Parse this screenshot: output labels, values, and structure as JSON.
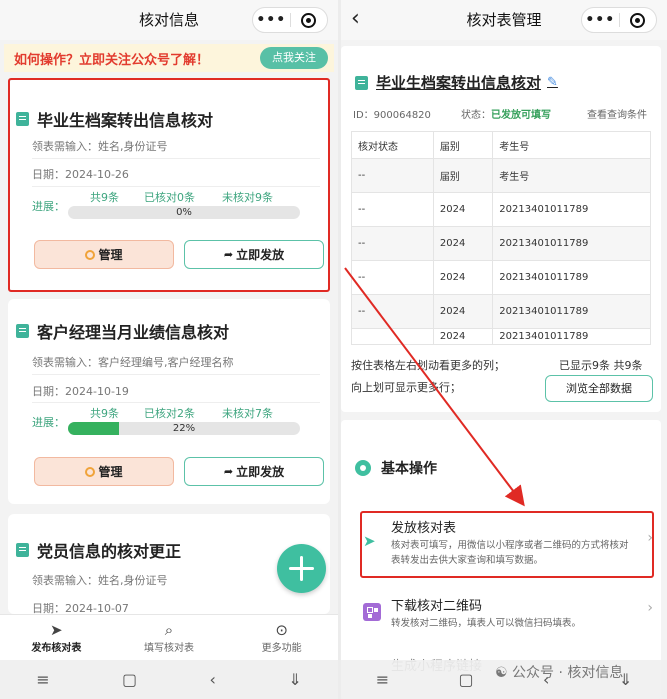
{
  "left": {
    "title": "核对信息",
    "banner": {
      "text": "如何操作？立即关注公众号了解！",
      "follow_label": "点我关注"
    },
    "cards": [
      {
        "title": "毕业生档案转出信息核对",
        "fields_label": "领表需输入：姓名,身份证号",
        "date_label": "日期：2024-10-26",
        "progress_label": "进展：",
        "total": "共9条",
        "checked": "已核对0条",
        "unchecked": "未核对9条",
        "progress_text": "0%",
        "progress_value": 0,
        "manage_label": "管理",
        "send_label": "立即发放"
      },
      {
        "title": "客户经理当月业绩信息核对",
        "fields_label": "领表需输入：客户经理编号,客户经理名称",
        "date_label": "日期：2024-10-19",
        "progress_label": "进展：",
        "total": "共9条",
        "checked": "已核对2条",
        "unchecked": "未核对7条",
        "progress_text": "22%",
        "progress_value": 22,
        "manage_label": "管理",
        "send_label": "立即发放"
      },
      {
        "title": "党员信息的核对更正",
        "fields_label": "领表需输入：姓名,身份证号",
        "date_label": "日期：2024-10-07"
      }
    ],
    "tabs": [
      {
        "label": "发布核对表",
        "icon": "send-icon"
      },
      {
        "label": "填写核对表",
        "icon": "search-icon"
      },
      {
        "label": "更多功能",
        "icon": "more-icon"
      }
    ]
  },
  "right": {
    "title": "核对表管理",
    "sheet_title": "毕业生档案转出信息核对",
    "id_label": "ID：900064820",
    "status_label": "状态：",
    "status_value": "已发放可填写",
    "view_conditions": "查看查询条件",
    "table": {
      "headers": [
        "核对状态",
        "届别",
        "考生号"
      ],
      "rows": [
        [
          "--",
          "届别",
          "考生号"
        ],
        [
          "--",
          "2024",
          "20213401011789"
        ],
        [
          "--",
          "2024",
          "20213401011789"
        ],
        [
          "--",
          "2024",
          "20213401011789"
        ],
        [
          "--",
          "2024",
          "20213401011789"
        ],
        [
          "",
          "2024",
          "20213401011789"
        ]
      ]
    },
    "hint1": "按住表格左右划动看更多的列；",
    "hint2": "向上划可显示更多行；",
    "shown_count": "已显示9条 共9条",
    "browse_label": "浏览全部数据",
    "section_title": "基本操作",
    "ops": [
      {
        "title": "发放核对表",
        "desc": "核对表可填写，用微信以小程序或者二维码的方式将核对表转发出去供大家查询和填写数据。"
      },
      {
        "title": "下载核对二维码",
        "desc": "转发核对二维码，填表人可以微信扫码填表。"
      },
      {
        "title": "生成小程序链接",
        "desc": ""
      }
    ],
    "watermark": "公众号 · 核对信息"
  },
  "colors": {
    "accent": "#3fbfa0",
    "highlight": "#e02a24",
    "progress": "#35b15e",
    "banner_text": "#e23b2e"
  }
}
